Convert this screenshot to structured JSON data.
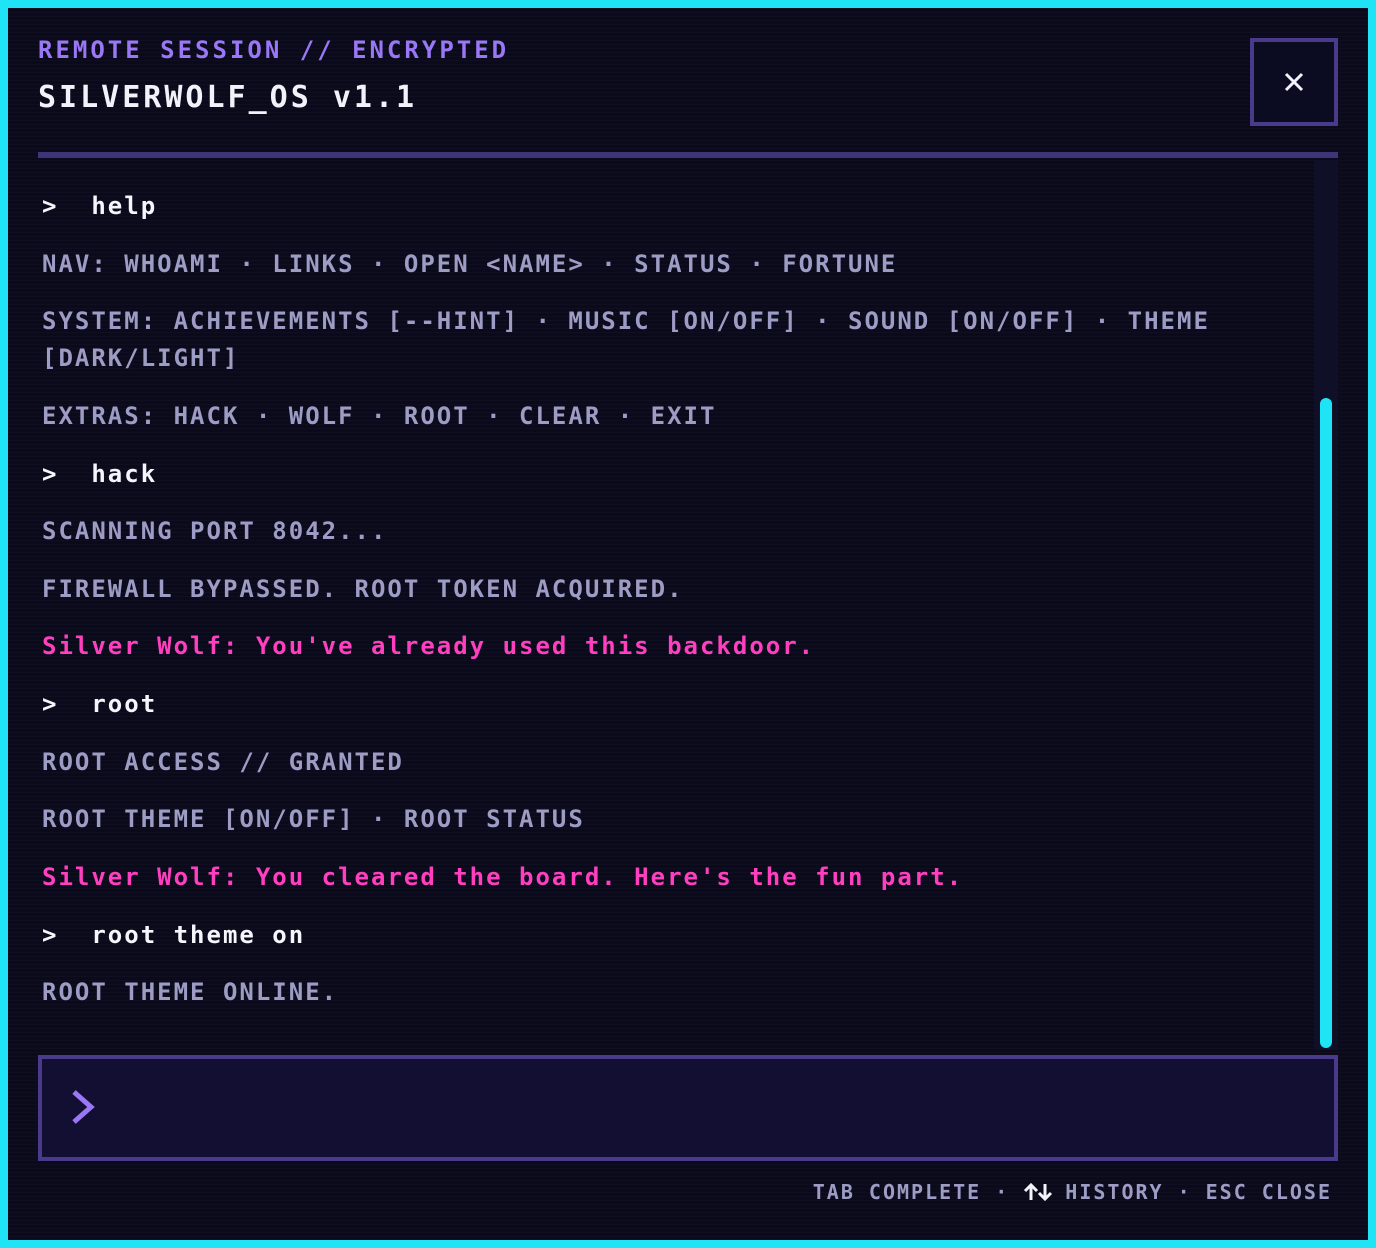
{
  "header": {
    "subtitle": "REMOTE SESSION // ENCRYPTED",
    "title": "SILVERWOLF_OS v1.1",
    "close_icon": "close-icon"
  },
  "terminal": {
    "lines": [
      {
        "kind": "cmd",
        "prompt": ">",
        "text": "help"
      },
      {
        "kind": "sys",
        "text": "NAV: WHOAMI · LINKS · OPEN <NAME> · STATUS · FORTUNE"
      },
      {
        "kind": "sys",
        "text": "SYSTEM: ACHIEVEMENTS [--HINT] · MUSIC [ON/OFF] · SOUND [ON/OFF] · THEME [DARK/LIGHT]"
      },
      {
        "kind": "sys",
        "text": "EXTRAS: HACK · WOLF · ROOT · CLEAR · EXIT"
      },
      {
        "kind": "cmd",
        "prompt": ">",
        "text": "hack"
      },
      {
        "kind": "sys",
        "text": "SCANNING PORT 8042..."
      },
      {
        "kind": "sys",
        "text": "FIREWALL BYPASSED. ROOT TOKEN ACQUIRED."
      },
      {
        "kind": "wolf",
        "text": "Silver Wolf: You've already used this backdoor."
      },
      {
        "kind": "cmd",
        "prompt": ">",
        "text": "root"
      },
      {
        "kind": "sys",
        "text": "ROOT ACCESS // GRANTED"
      },
      {
        "kind": "sys",
        "text": "ROOT THEME [ON/OFF] · ROOT STATUS"
      },
      {
        "kind": "wolf",
        "text": "Silver Wolf: You cleared the board. Here's the fun part."
      },
      {
        "kind": "cmd",
        "prompt": ">",
        "text": "root theme on"
      },
      {
        "kind": "sys",
        "text": "ROOT THEME ONLINE."
      }
    ]
  },
  "input": {
    "prompt_icon": "chevron-right-icon",
    "value": "",
    "placeholder": ""
  },
  "footer": {
    "tab_hint": "TAB COMPLETE",
    "history_icon": "up-down-arrows-icon",
    "history_hint": "HISTORY",
    "esc_hint": "ESC CLOSE",
    "separator": "·"
  },
  "colors": {
    "accent_cyan": "#1ee4f5",
    "accent_purple": "#9a77f5",
    "wolf_pink": "#ff3fbf",
    "text_muted": "#9d9cc4",
    "background": "#0a0a1c"
  }
}
